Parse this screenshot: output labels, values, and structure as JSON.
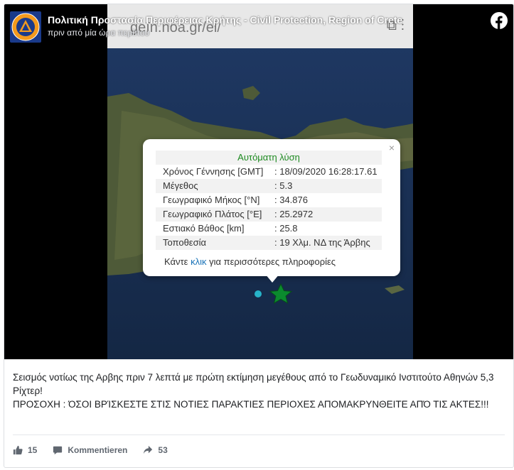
{
  "post": {
    "page_name": "Πολιτική Προστασία Περιφέρειας Κρήτης - Civil Protection, Region of Crete",
    "timestamp": "πριν από μία ώρα περίπου",
    "caption_line1": "Σεισμός νοτίως της Αρβης πριν 7 λεπτά με πρώτη εκτίμηση μεγέθους από το Γεωδυναμικό Ινστιτούτο Αθηνών 5,3 Ρίχτερ!",
    "caption_line2": "ΠΡΟΣΟΧΗ : ΌΣΟΙ ΒΡΊΣΚΕΣΤΕ ΣΤΙΣ ΝΟΤΙΕΣ ΠΑΡΑΚΤΙΕΣ ΠΕΡΙΟΧΕΣ ΑΠΟΜΑΚΡΥΝΘΕΙΤΕ ΑΠΌ ΤΙΣ ΑΚΤΕΣ!!!"
  },
  "screenshot": {
    "url_text": "geïn.noa.gr/el/",
    "popup": {
      "title": "Αυτόματη λύση",
      "close": "×",
      "rows": [
        {
          "label": "Χρόνος Γέννησης [GMT]",
          "value": ": 18/09/2020 16:28:17.61"
        },
        {
          "label": "Μέγεθος",
          "value": ": 5.3"
        },
        {
          "label": "Γεωγραφικό Μήκος [°N]",
          "value": ": 34.876"
        },
        {
          "label": "Γεωγραφικό Πλάτος [°E]",
          "value": ": 25.2972"
        },
        {
          "label": "Εστιακό Βάθος [km]",
          "value": ": 25.8"
        },
        {
          "label": "Τοποθεσία",
          "value": ": 19 Χλμ. ΝΔ της Άρβης"
        }
      ],
      "more_prefix": "Κάντε ",
      "more_link": "κλικ",
      "more_suffix": " για περισσότερες πληροφορίες"
    }
  },
  "actions": {
    "likes": "15",
    "comment_label": "Kommentieren",
    "shares": "53"
  },
  "colors": {
    "popup_title": "#1d8a20",
    "link": "#1a73b8",
    "epicenter_star": "#0b8a2e",
    "station_dot": "#27b3c9"
  }
}
